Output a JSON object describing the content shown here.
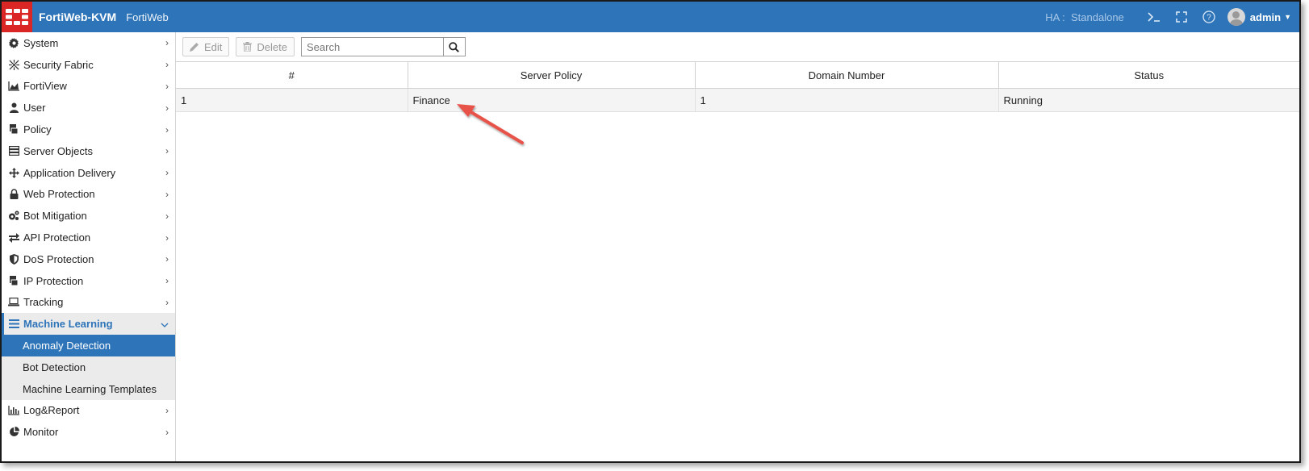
{
  "header": {
    "product": "FortiWeb-KVM",
    "subproduct": "FortiWeb",
    "ha_label": "HA :",
    "ha_value": "Standalone",
    "user": "admin",
    "icons": [
      "fortinet-logo",
      "cli-icon",
      "fullscreen-icon",
      "help-icon",
      "avatar-icon",
      "caret-down-icon"
    ]
  },
  "sidebar": {
    "items": [
      {
        "label": "System",
        "icon": "gear-icon"
      },
      {
        "label": "Security Fabric",
        "icon": "fabric-icon"
      },
      {
        "label": "FortiView",
        "icon": "area-chart-icon"
      },
      {
        "label": "User",
        "icon": "user-icon"
      },
      {
        "label": "Policy",
        "icon": "policy-icon"
      },
      {
        "label": "Server Objects",
        "icon": "server-icon"
      },
      {
        "label": "Application Delivery",
        "icon": "arrows-icon"
      },
      {
        "label": "Web Protection",
        "icon": "lock-icon"
      },
      {
        "label": "Bot Mitigation",
        "icon": "cogs-icon"
      },
      {
        "label": "API Protection",
        "icon": "exchange-icon"
      },
      {
        "label": "DoS Protection",
        "icon": "shield-icon"
      },
      {
        "label": "IP Protection",
        "icon": "policy-icon"
      },
      {
        "label": "Tracking",
        "icon": "laptop-icon"
      },
      {
        "label": "Machine Learning",
        "icon": "bars-icon"
      },
      {
        "label": "Log&Report",
        "icon": "bar-chart-icon"
      },
      {
        "label": "Monitor",
        "icon": "pie-chart-icon"
      }
    ],
    "ml_sub": [
      "Anomaly Detection",
      "Bot Detection",
      "Machine Learning Templates"
    ]
  },
  "toolbar": {
    "edit_label": "Edit",
    "delete_label": "Delete",
    "search_placeholder": "Search"
  },
  "table": {
    "columns": [
      "#",
      "Server Policy",
      "Domain Number",
      "Status"
    ],
    "rows": [
      [
        "1",
        "Finance",
        "1",
        "Running"
      ]
    ]
  },
  "colors": {
    "header_blue": "#2e74b9",
    "logo_red": "#da2726",
    "annotation_arrow": "#e8534a"
  }
}
